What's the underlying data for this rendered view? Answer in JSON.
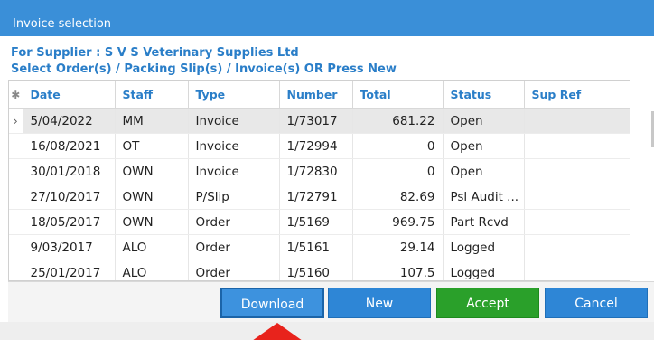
{
  "window": {
    "title": "Invoice selection"
  },
  "header": {
    "supplier_line": "For Supplier : S V S Veterinary Supplies Ltd",
    "instruction_line": "Select  Order(s)  / Packing Slip(s)  / Invoice(s)  OR  Press New"
  },
  "grid": {
    "selector_header": "✱",
    "columns": [
      "Date",
      "Staff",
      "Type",
      "Number",
      "Total",
      "Status",
      "Sup Ref"
    ],
    "rows": [
      {
        "marker": "›",
        "date": "5/04/2022",
        "staff": "MM",
        "type": "Invoice",
        "number": "1/73017",
        "total": "681.22",
        "status": "Open",
        "sup_ref": ""
      },
      {
        "marker": "",
        "date": "16/08/2021",
        "staff": "OT",
        "type": "Invoice",
        "number": "1/72994",
        "total": "0",
        "status": "Open",
        "sup_ref": ""
      },
      {
        "marker": "",
        "date": "30/01/2018",
        "staff": "OWN",
        "type": "Invoice",
        "number": "1/72830",
        "total": "0",
        "status": "Open",
        "sup_ref": ""
      },
      {
        "marker": "",
        "date": "27/10/2017",
        "staff": "OWN",
        "type": "P/Slip",
        "number": "1/72791",
        "total": "82.69",
        "status": "Psl Audit ...",
        "sup_ref": ""
      },
      {
        "marker": "",
        "date": "18/05/2017",
        "staff": "OWN",
        "type": "Order",
        "number": "1/5169",
        "total": "969.75",
        "status": "Part Rcvd",
        "sup_ref": ""
      },
      {
        "marker": "",
        "date": "9/03/2017",
        "staff": "ALO",
        "type": "Order",
        "number": "1/5161",
        "total": "29.14",
        "status": "Logged",
        "sup_ref": ""
      },
      {
        "marker": "",
        "date": "25/01/2017",
        "staff": "ALO",
        "type": "Order",
        "number": "1/5160",
        "total": "107.5",
        "status": "Logged",
        "sup_ref": ""
      }
    ]
  },
  "buttons": {
    "download": "Download",
    "new": "New",
    "accept": "Accept",
    "cancel": "Cancel"
  },
  "colors": {
    "titlebar": "#3a8fd8",
    "header_text": "#2a7ec8",
    "accept": "#2aa02a",
    "button_blue": "#2e86d6",
    "arrow": "#e8231c"
  },
  "icons": {
    "row_marker": "current-row-indicator-icon",
    "arrow": "red-arrow-icon"
  }
}
